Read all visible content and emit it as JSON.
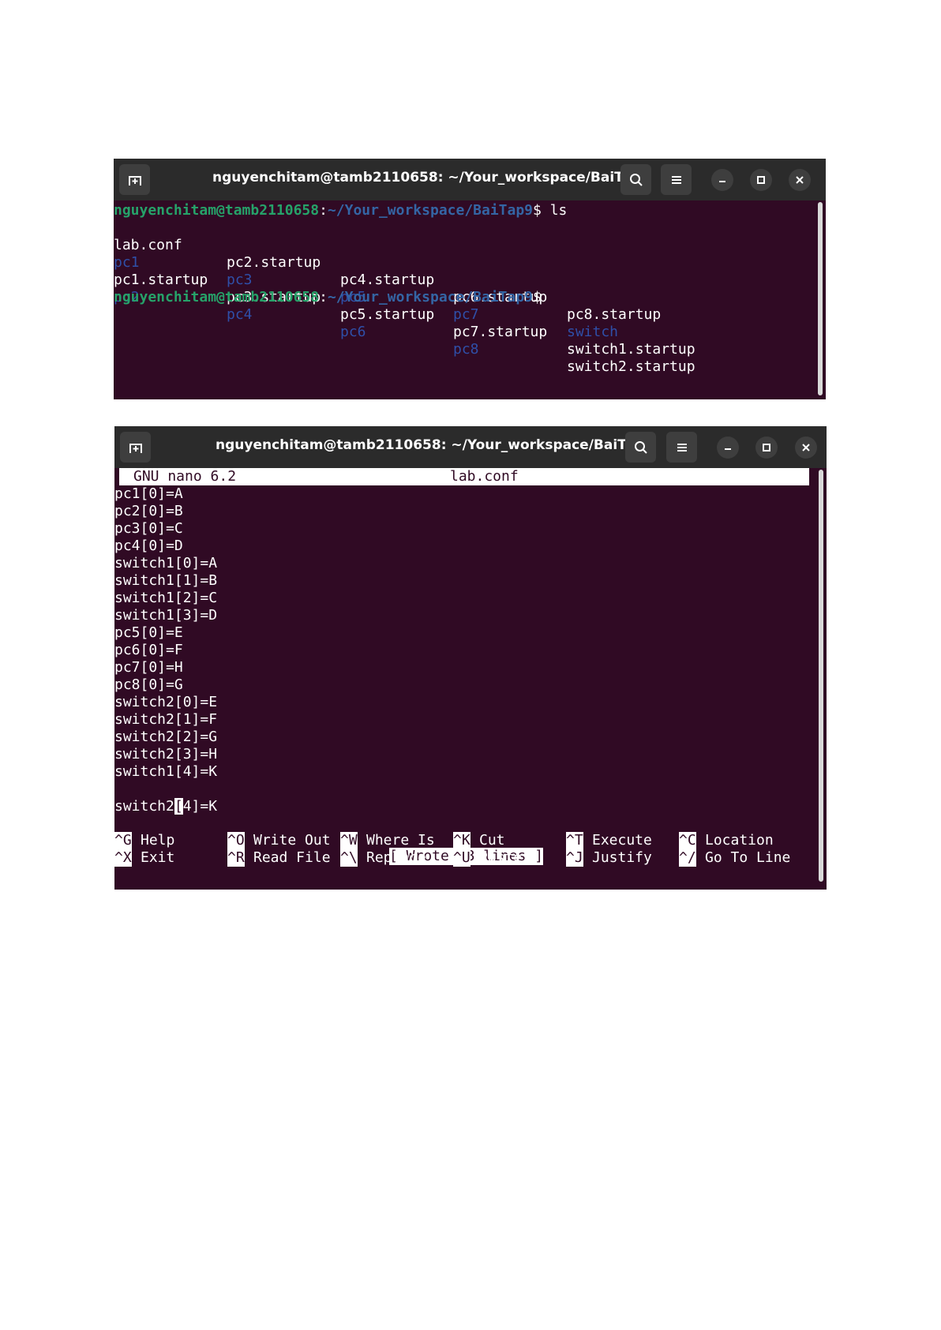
{
  "terminal1": {
    "title": "nguyenchitam@tamb2110658: ~/Your_workspace/BaiTap9",
    "prompt_user": "nguyenchitam@tamb2110658",
    "prompt_sep": ":",
    "prompt_path": "~/Your_workspace/BaiTap9",
    "prompt_symbol": "$",
    "command": " ls",
    "ls_rows": [
      [
        "lab.conf",
        "pc2.startup",
        "pc4.startup",
        "pc6.startup",
        "pc8.startup"
      ],
      [
        "pc1",
        "pc3",
        "pc5",
        "pc7",
        "switch"
      ],
      [
        "pc1.startup",
        "pc3.startup",
        "pc5.startup",
        "pc7.startup",
        "switch1.startup"
      ],
      [
        "pc2",
        "pc4",
        "pc6",
        "pc8",
        "switch2.startup"
      ]
    ]
  },
  "terminal2": {
    "title": "nguyenchitam@tamb2110658: ~/Your_workspace/BaiTap9",
    "nano_version": "GNU nano 6.2",
    "file_name": "lab.conf",
    "lines": [
      "pc1[0]=A",
      "pc2[0]=B",
      "pc3[0]=C",
      "pc4[0]=D",
      "switch1[0]=A",
      "switch1[1]=B",
      "switch1[2]=C",
      "switch1[3]=D",
      "pc5[0]=E",
      "pc6[0]=F",
      "pc7[0]=H",
      "pc8[0]=G",
      "switch2[0]=E",
      "switch2[1]=F",
      "switch2[2]=G",
      "switch2[3]=H",
      "switch1[4]=K"
    ],
    "last_line_before": "switch2",
    "last_line_cursor": "[",
    "last_line_after": "4]=K",
    "status": "[ Wrote 18 lines ]",
    "shortcuts_row1": [
      {
        "key": "^G",
        "label": "Help"
      },
      {
        "key": "^O",
        "label": "Write Out"
      },
      {
        "key": "^W",
        "label": "Where Is"
      },
      {
        "key": "^K",
        "label": "Cut"
      },
      {
        "key": "^T",
        "label": "Execute"
      },
      {
        "key": "^C",
        "label": "Location"
      }
    ],
    "shortcuts_row2": [
      {
        "key": "^X",
        "label": "Exit"
      },
      {
        "key": "^R",
        "label": "Read File"
      },
      {
        "key": "^\\",
        "label": "Replace"
      },
      {
        "key": "^U",
        "label": "Paste"
      },
      {
        "key": "^J",
        "label": "Justify"
      },
      {
        "key": "^/",
        "label": "Go To Line"
      }
    ]
  },
  "icons": [
    "new-tab-icon",
    "search-icon",
    "menu-icon",
    "minimize-icon",
    "maximize-icon",
    "close-icon"
  ]
}
